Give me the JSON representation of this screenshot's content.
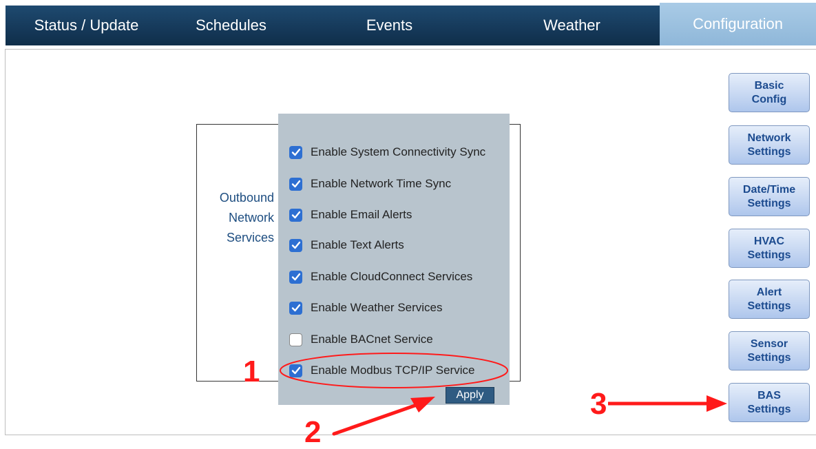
{
  "nav": {
    "tabs": [
      {
        "label": "Status / Update"
      },
      {
        "label": "Schedules"
      },
      {
        "label": "Events"
      },
      {
        "label": "Weather"
      },
      {
        "label": "Configuration"
      }
    ],
    "active_tab": "Configuration"
  },
  "services": {
    "label": "Outbound\nNetwork\nServices",
    "options": [
      {
        "label": "Enable System Connectivity Sync",
        "checked": true
      },
      {
        "label": "Enable Network Time Sync",
        "checked": true
      },
      {
        "label": "Enable Email Alerts",
        "checked": true
      },
      {
        "label": "Enable Text Alerts",
        "checked": true
      },
      {
        "label": "Enable CloudConnect Services",
        "checked": true
      },
      {
        "label": "Enable Weather Services",
        "checked": true
      },
      {
        "label": "Enable BACnet Service",
        "checked": false
      },
      {
        "label": "Enable Modbus TCP/IP Service",
        "checked": true
      }
    ],
    "apply_label": "Apply"
  },
  "sidebar": {
    "buttons": [
      {
        "label": "Basic\nConfig"
      },
      {
        "label": "Network\nSettings"
      },
      {
        "label": "Date/Time\nSettings"
      },
      {
        "label": "HVAC\nSettings"
      },
      {
        "label": "Alert\nSettings"
      },
      {
        "label": "Sensor\nSettings"
      },
      {
        "label": "BAS\nSettings"
      }
    ]
  },
  "annotations": {
    "step1": "1",
    "step2": "2",
    "step3": "3",
    "color": "#ff1a1a"
  },
  "colors": {
    "nav_bg": "#163a5b",
    "active_tab_bg": "#9cc1e0",
    "checkbox_on": "#2d6fd2",
    "apply_bg": "#2f5b82",
    "side_btn_text": "#1c4b8f"
  }
}
